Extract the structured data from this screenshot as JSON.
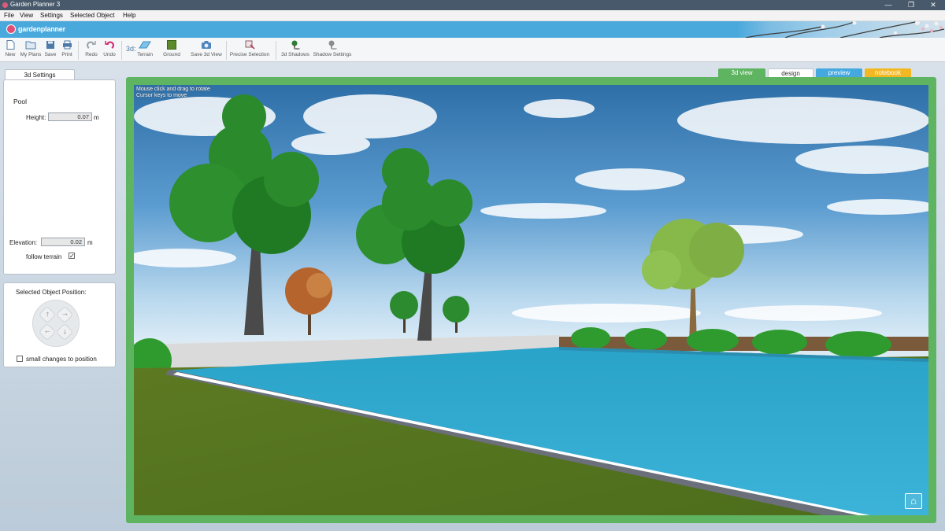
{
  "window": {
    "title": "Garden Planner 3",
    "controls": {
      "minimize": "—",
      "maximize": "❐",
      "close": "✕"
    }
  },
  "menu": [
    "File",
    "View",
    "Settings",
    "Selected Object",
    "Help"
  ],
  "brand": {
    "logo_text": "gardenplanner"
  },
  "toolbar": {
    "new": "New",
    "my_plans": "My Plans",
    "save": "Save",
    "print": "Print",
    "redo": "Redo",
    "undo": "Undo",
    "mode_prefix": "3d:",
    "terrain": "Terrain",
    "ground": "Ground",
    "save_3d_view": "Save 3d View",
    "precise_selection": "Precise Selection",
    "3d_shadows": "3d Shadows",
    "shadow_settings": "Shadow Settings"
  },
  "settings_panel": {
    "tab_label": "3d Settings",
    "object_name": "Pool",
    "height_label": "Height:",
    "height_value": "0.07",
    "height_unit": "m",
    "elevation_label": "Elevation:",
    "elevation_value": "0.02",
    "elevation_unit": "m",
    "follow_terrain_label": "follow terrain",
    "follow_terrain_checked": "✓"
  },
  "position_panel": {
    "title": "Selected Object Position:",
    "small_changes_label": "small changes to position"
  },
  "view_tabs": [
    {
      "label": "3d view",
      "color": "#5fb462",
      "active": true
    },
    {
      "label": "design",
      "color": "#ffffff",
      "active": false
    },
    {
      "label": "preview",
      "color": "#45a9e0",
      "active": false
    },
    {
      "label": "notebook",
      "color": "#f2b824",
      "active": false
    }
  ],
  "viewport": {
    "hint_line1": "Mouse click and drag to rotate",
    "hint_line2": "Cursor keys to move",
    "home_icon": "⌂"
  },
  "colors": {
    "frame_green": "#5fb462",
    "brand_blue": "#4aa9dc",
    "title_bar": "#47596b",
    "pool_water": "#2fa6c7"
  }
}
